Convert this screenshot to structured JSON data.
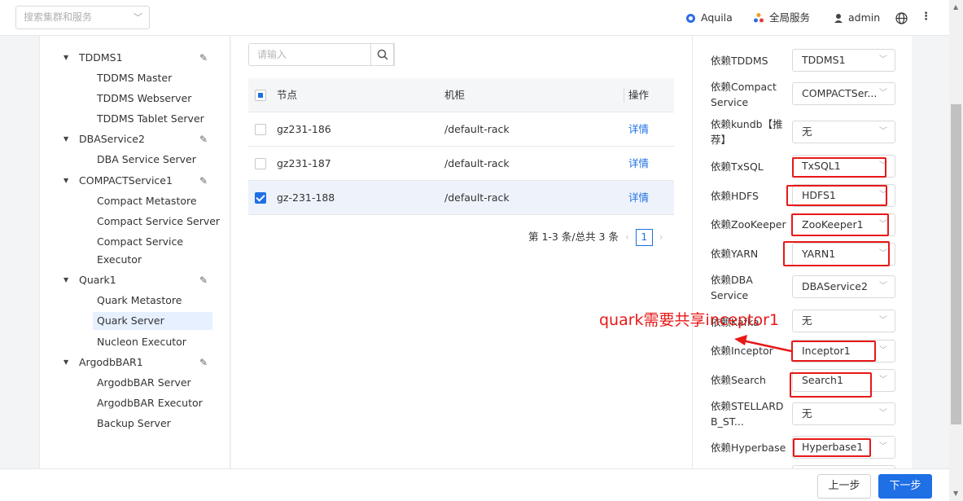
{
  "topbar": {
    "search_placeholder": "搜索集群和服务",
    "user1": "Aquila",
    "global_service": "全局服务",
    "admin": "admin",
    "kebab": "⋮"
  },
  "tree": {
    "groups": [
      {
        "name": "TDDMS1",
        "items": [
          "TDDMS Master",
          "TDDMS Webserver",
          "TDDMS Tablet Server"
        ]
      },
      {
        "name": "DBAService2",
        "items": [
          "DBA Service Server"
        ]
      },
      {
        "name": "COMPACTService1",
        "items": [
          "Compact Metastore",
          "Compact Service Server",
          "Compact Service",
          "Executor"
        ]
      },
      {
        "name": "Quark1",
        "items": [
          "Quark Metastore",
          "Quark Server",
          "Nucleon Executor"
        ]
      },
      {
        "name": "ArgodbBAR1",
        "items": [
          "ArgodbBAR Server",
          "ArgodbBAR Executor",
          "Backup Server"
        ]
      }
    ],
    "selected": "Quark Server"
  },
  "nodes": {
    "search_placeholder": "请输入",
    "columns": {
      "node": "节点",
      "rack": "机柜",
      "action": "操作"
    },
    "rows": [
      {
        "node": "gz231-186",
        "rack": "/default-rack",
        "action": "详情",
        "checked": false
      },
      {
        "node": "gz231-187",
        "rack": "/default-rack",
        "action": "详情",
        "checked": false
      },
      {
        "node": "gz-231-188",
        "rack": "/default-rack",
        "action": "详情",
        "checked": true
      }
    ],
    "pager_text": "第 1-3 条/总共 3 条",
    "page": "1"
  },
  "deps": [
    {
      "label": "依赖TDDMS",
      "value": "TDDMS1"
    },
    {
      "label": "依赖Compact Service",
      "value": "COMPACTSer..."
    },
    {
      "label": "依赖kundb【推荐】",
      "value": "无"
    },
    {
      "label": "依赖TxSQL",
      "value": "TxSQL1"
    },
    {
      "label": "依赖HDFS",
      "value": "HDFS1"
    },
    {
      "label": "依赖ZooKeeper",
      "value": "ZooKeeper1"
    },
    {
      "label": "依赖YARN",
      "value": "YARN1"
    },
    {
      "label": "依赖DBA Service",
      "value": "DBAService2"
    },
    {
      "label": "依赖Kafka",
      "value": "无"
    },
    {
      "label": "依赖Inceptor",
      "value": "Inceptor1"
    },
    {
      "label": "依赖Search",
      "value": "Search1"
    },
    {
      "label": "依赖STELLARDB_ST...",
      "value": "无"
    },
    {
      "label": "依赖Hyperbase",
      "value": "Hyperbase1"
    }
  ],
  "annotation": "quark需要共享inceptor1",
  "footer": {
    "prev": "上一步",
    "next": "下一步"
  },
  "colors": {
    "accent": "#1f6fe5",
    "annotation": "#e81818"
  }
}
